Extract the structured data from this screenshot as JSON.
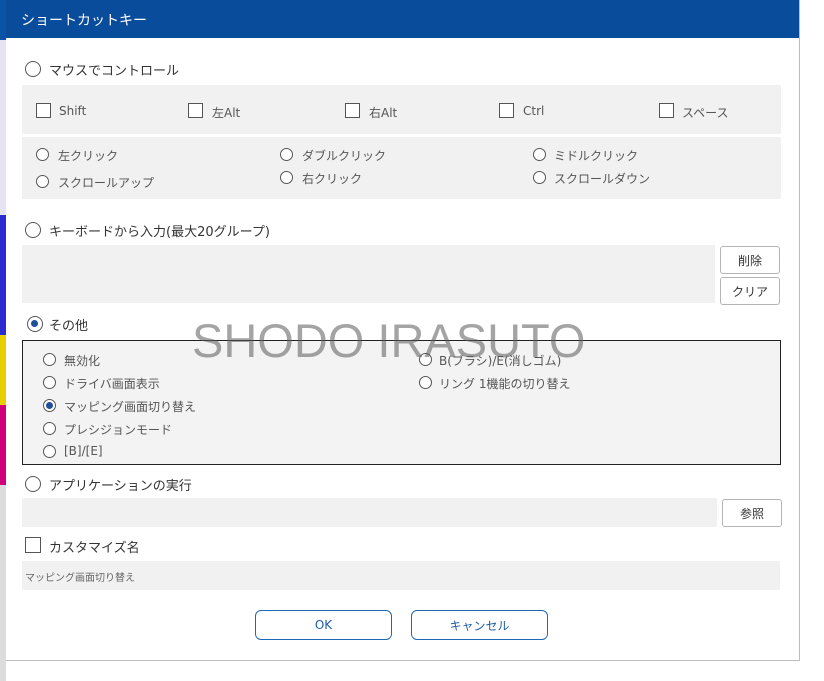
{
  "window": {
    "title": "ショートカットキー"
  },
  "mouse_section": {
    "label": "マウスでコントロール",
    "modifiers": [
      "Shift",
      "左Alt",
      "右Alt",
      "Ctrl",
      "スペース"
    ],
    "clicks": [
      "左クリック",
      "ダブルクリック",
      "ミドルクリック",
      "スクロールアップ",
      "右クリック",
      "スクロールダウン"
    ]
  },
  "keyboard_section": {
    "label": "キーボードから入力(最大20グループ)",
    "delete_label": "削除",
    "clear_label": "クリア"
  },
  "other_section": {
    "label": "その他",
    "options": [
      "無効化",
      "ドライバ画面表示",
      "マッピング画面切り替え",
      "プレシジョンモード",
      "[B]/[E]",
      "B(ブラシ)/E(消しゴム)",
      "リング 1機能の切り替え"
    ],
    "selected": "マッピング画面切り替え"
  },
  "app_section": {
    "label": "アプリケーションの実行",
    "browse_label": "参照"
  },
  "custom_name": {
    "label": "カスタマイズ名",
    "value": "マッピング画面切り替え"
  },
  "footer": {
    "ok_label": "OK",
    "cancel_label": "キャンセル"
  },
  "watermark": "SHODO IRASUTO"
}
